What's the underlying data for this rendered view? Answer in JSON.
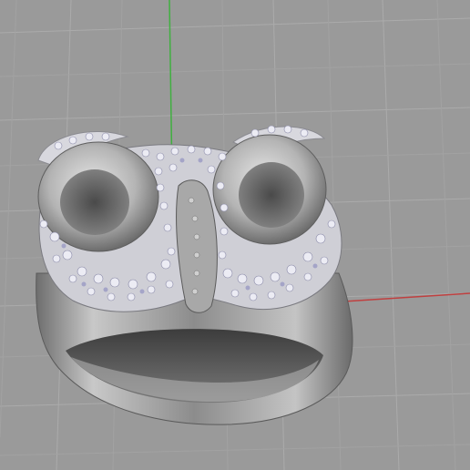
{
  "viewport": {
    "view": "perspective",
    "background_color": "#9a9a9a",
    "grid_line_color": "#aaaaaa",
    "grid_minor_color": "#a2a2a2",
    "axis_x_color": "#c04040",
    "axis_y_color": "#40b040"
  },
  "model": {
    "object": "owl-ring",
    "metal_color": "#b8b8b8",
    "pave_stone_color": "#e4e4ee",
    "stone_tint": "#8a8ab0"
  }
}
